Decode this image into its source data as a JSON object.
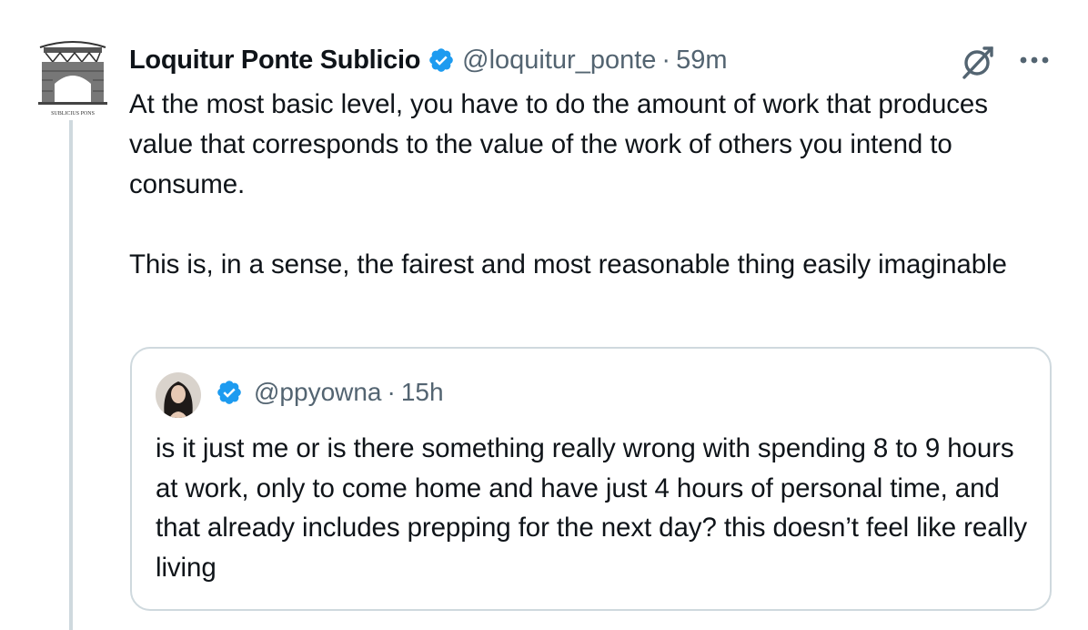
{
  "tweet": {
    "author_name": "Loquitur Ponte Sublicio",
    "handle": "@loquitur_ponte",
    "separator": "·",
    "time": "59m",
    "avatar_caption": "SUBLICIUS PONS",
    "text": "At the most basic level, you have to do the amount of work that produces value that corresponds to the value of the work of others you intend to consume.\n\nThis is, in a sense, the fairest and most reasonable thing easily imaginable"
  },
  "quoted_tweet": {
    "handle": "@ppyowna",
    "separator": "·",
    "time": "15h",
    "text": "is it just me or is there something really wrong with spending 8 to 9 hours at work, only to come home and have just 4 hours of personal time, and that already includes prepping for the next day? this doesn’t feel like really living"
  },
  "icons": {
    "verified": "verified-badge-icon",
    "grok": "grok-icon",
    "more": "more-icon"
  },
  "colors": {
    "verified_blue": "#1d9bf0",
    "secondary_text": "#536471",
    "border": "#cfd9de",
    "text": "#0f1419"
  }
}
